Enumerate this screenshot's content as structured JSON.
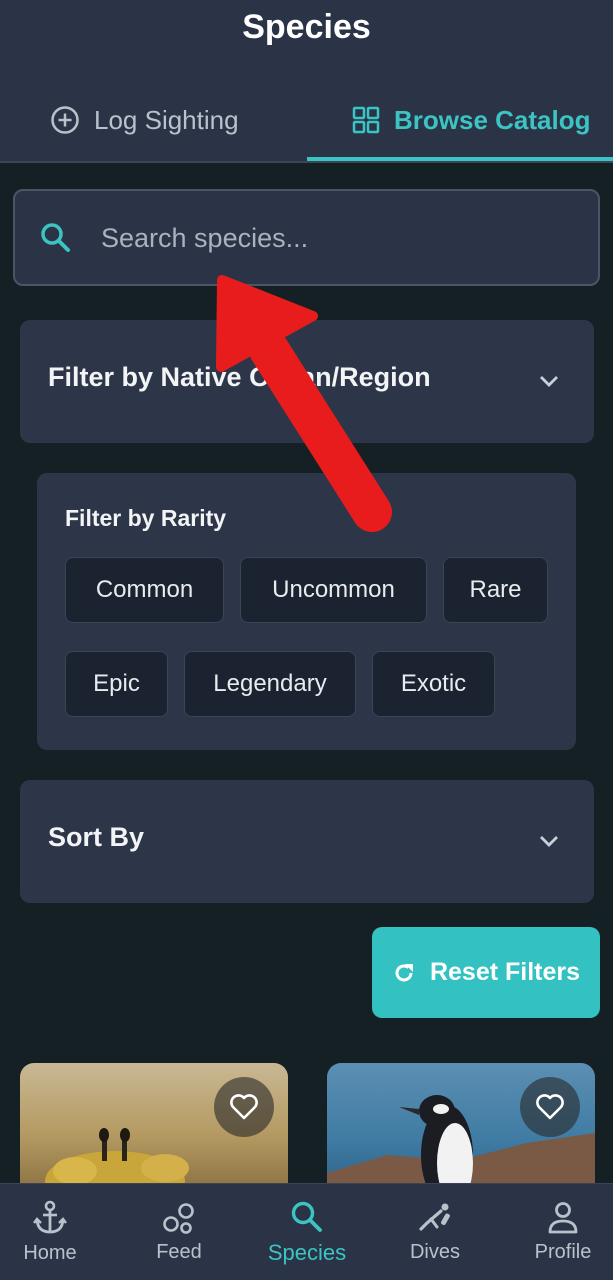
{
  "header": {
    "title": "Species",
    "tabs": [
      {
        "label": "Log Sighting",
        "icon": "plus-circle-icon",
        "active": false
      },
      {
        "label": "Browse Catalog",
        "icon": "grid-icon",
        "active": true
      }
    ]
  },
  "search": {
    "placeholder": "Search species...",
    "value": ""
  },
  "filters": {
    "region": {
      "label": "Filter by Native Ocean/Region"
    },
    "rarity": {
      "label": "Filter by Rarity",
      "options": [
        "Common",
        "Uncommon",
        "Rare",
        "Epic",
        "Legendary",
        "Exotic"
      ]
    },
    "sort": {
      "label": "Sort By"
    },
    "reset_label": "Reset Filters"
  },
  "cards": [
    {
      "subject": "crab",
      "icon": "heart-icon"
    },
    {
      "subject": "penguin",
      "icon": "heart-icon"
    }
  ],
  "bottom_nav": [
    {
      "label": "Home",
      "icon": "anchor-icon",
      "active": false
    },
    {
      "label": "Feed",
      "icon": "bubbles-icon",
      "active": false
    },
    {
      "label": "Species",
      "icon": "search-icon",
      "active": true
    },
    {
      "label": "Dives",
      "icon": "diver-icon",
      "active": false
    },
    {
      "label": "Profile",
      "icon": "person-icon",
      "active": false
    }
  ],
  "colors": {
    "accent": "#3cc3c3",
    "background": "#142023",
    "surface": "#2b3446",
    "annotation_arrow": "#e81c1c"
  }
}
